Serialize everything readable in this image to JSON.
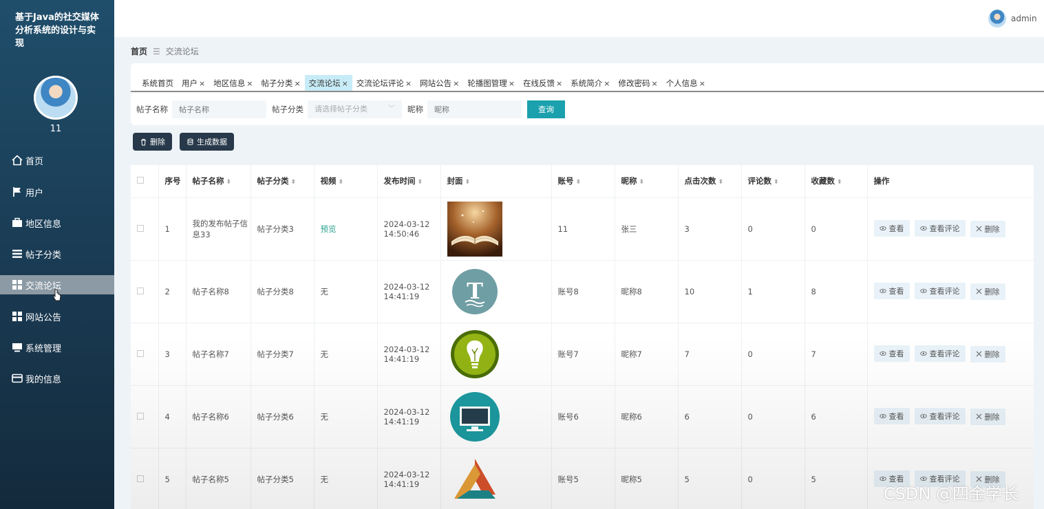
{
  "app": {
    "title": "基于Java的社交媒体分析系统的设计与实现",
    "user_num": "11",
    "admin": "admin"
  },
  "menu": [
    {
      "label": "首页",
      "icon": "home-icon"
    },
    {
      "label": "用户",
      "icon": "flag-icon"
    },
    {
      "label": "地区信息",
      "icon": "briefcase-icon"
    },
    {
      "label": "帖子分类",
      "icon": "list-icon"
    },
    {
      "label": "交流论坛",
      "icon": "grid-icon"
    },
    {
      "label": "网站公告",
      "icon": "grid-icon"
    },
    {
      "label": "系统管理",
      "icon": "monitor-icon"
    },
    {
      "label": "我的信息",
      "icon": "card-icon"
    }
  ],
  "breadcrumb": {
    "home": "首页",
    "current": "交流论坛"
  },
  "tabs": [
    "系统首页",
    "用户",
    "地区信息",
    "帖子分类",
    "交流论坛",
    "交流论坛评论",
    "网站公告",
    "轮播图管理",
    "在线反馈",
    "系统简介",
    "修改密码",
    "个人信息"
  ],
  "search": {
    "name_label": "帖子名称",
    "name_placeholder": "帖子名称",
    "cat_label": "帖子分类",
    "cat_placeholder": "请选择帖子分类",
    "nick_label": "昵称",
    "nick_placeholder": "昵称",
    "query": "查询"
  },
  "actions": {
    "delete": "删除",
    "generate": "生成数据"
  },
  "table": {
    "headers": [
      "序号",
      "帖子名称",
      "帖子分类",
      "视频",
      "发布时间",
      "封面",
      "账号",
      "昵称",
      "点击次数",
      "评论数",
      "收藏数",
      "操作"
    ],
    "ops": {
      "view": "查看",
      "view_comment": "查看评论",
      "delete": "删除"
    },
    "rows": [
      {
        "no": "1",
        "name": "我的发布帖子信息33",
        "cat": "帖子分类3",
        "video": "预览",
        "time": "2024-03-12 14:50:46",
        "cover": "book",
        "account": "11",
        "nick": "张三",
        "clicks": "3",
        "comments": "0",
        "favs": "0"
      },
      {
        "no": "2",
        "name": "帖子名称8",
        "cat": "帖子分类8",
        "video": "无",
        "time": "2024-03-12 14:41:19",
        "cover": "letter-t",
        "account": "账号8",
        "nick": "昵称8",
        "clicks": "10",
        "comments": "1",
        "favs": "8"
      },
      {
        "no": "3",
        "name": "帖子名称7",
        "cat": "帖子分类7",
        "video": "无",
        "time": "2024-03-12 14:41:19",
        "cover": "lightbulb",
        "account": "账号7",
        "nick": "昵称7",
        "clicks": "7",
        "comments": "0",
        "favs": "7"
      },
      {
        "no": "4",
        "name": "帖子名称6",
        "cat": "帖子分类6",
        "video": "无",
        "time": "2024-03-12 14:41:19",
        "cover": "monitor",
        "account": "账号6",
        "nick": "昵称6",
        "clicks": "6",
        "comments": "0",
        "favs": "6"
      },
      {
        "no": "5",
        "name": "帖子名称5",
        "cat": "帖子分类5",
        "video": "无",
        "time": "2024-03-12 14:41:19",
        "cover": "triangle",
        "account": "账号5",
        "nick": "昵称5",
        "clicks": "5",
        "comments": "0",
        "favs": "5"
      }
    ]
  },
  "watermark": "CSDN @四金学长"
}
